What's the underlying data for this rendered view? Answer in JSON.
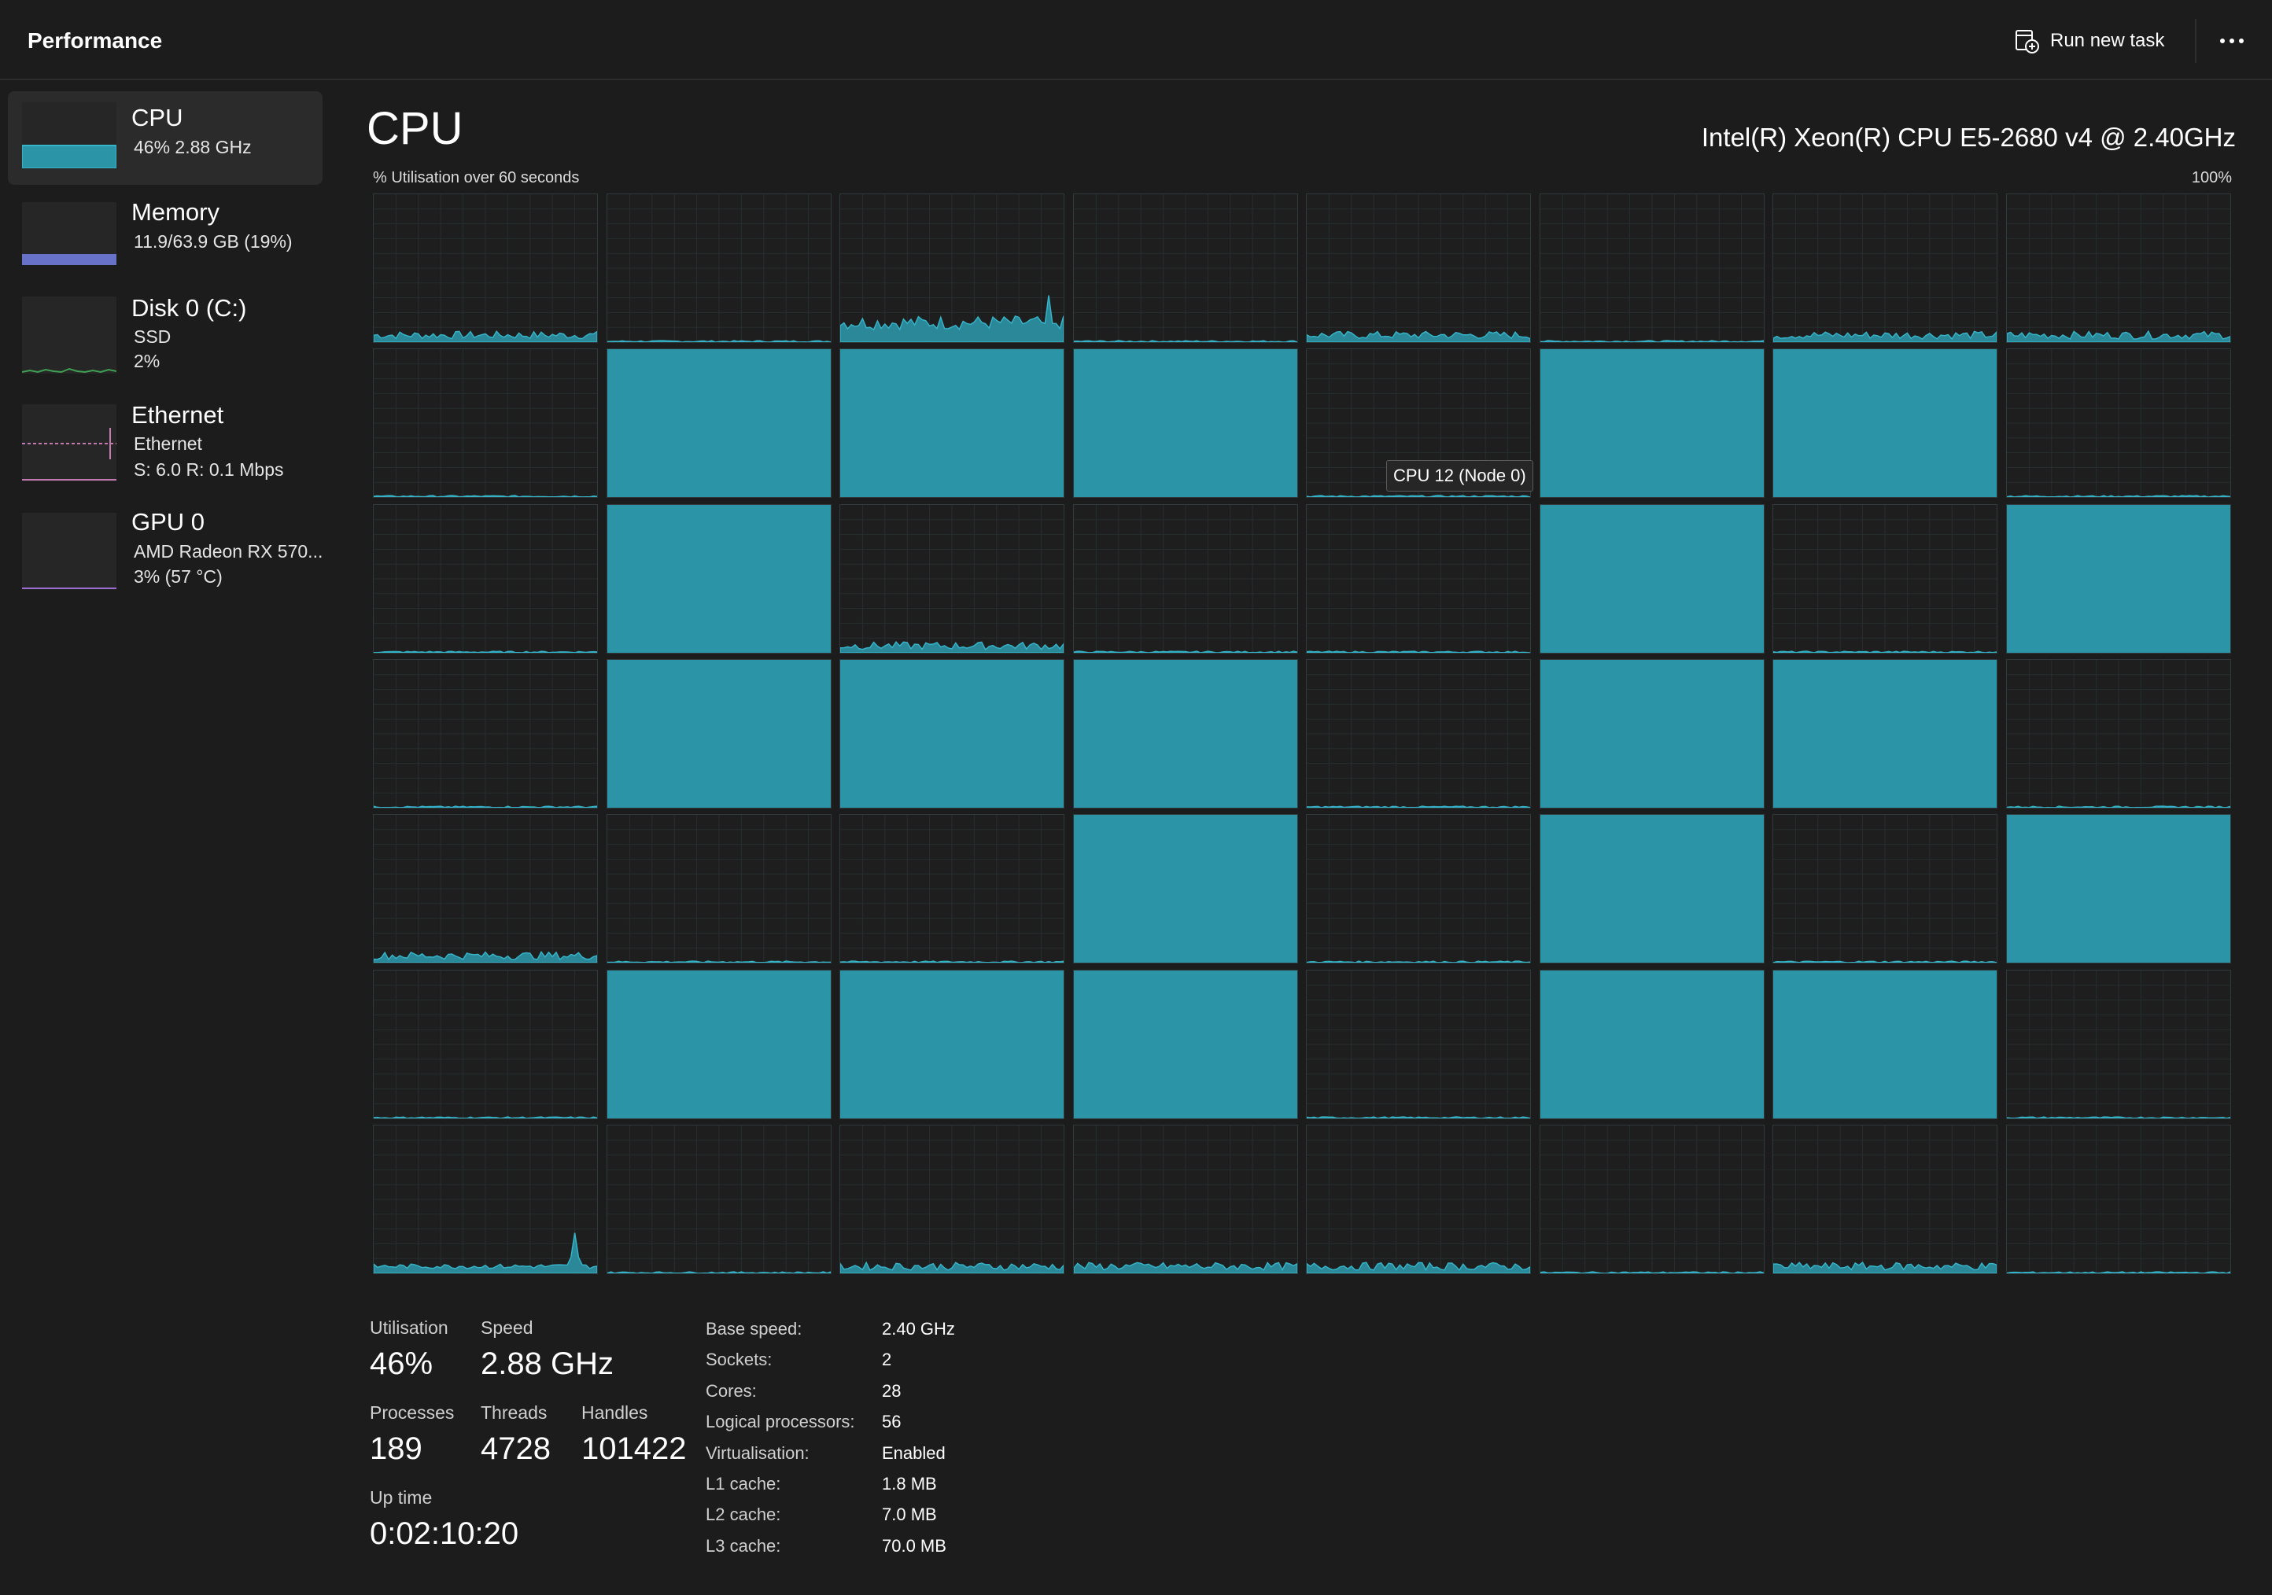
{
  "header": {
    "title": "Performance",
    "run_new_task": "Run new task",
    "more_icon": "more-horizontal-icon",
    "run_icon": "run-task-icon"
  },
  "sidebar": {
    "items": [
      {
        "name": "CPU",
        "details": [
          "46%  2.88 GHz"
        ],
        "color": "#2b94a6",
        "level": 0.46,
        "selected": true
      },
      {
        "name": "Memory",
        "details": [
          "11.9/63.9 GB (19%)"
        ],
        "color": "#7280d4",
        "level": 0.19,
        "selected": false
      },
      {
        "name": "Disk 0 (C:)",
        "details": [
          "SSD",
          "2%"
        ],
        "color": "#3f9f52",
        "level": 0.02,
        "selected": false
      },
      {
        "name": "Ethernet",
        "details": [
          "Ethernet",
          "S: 6.0  R: 0.1 Mbps"
        ],
        "color": "#c27ab0",
        "selected": false
      },
      {
        "name": "GPU 0",
        "details": [
          "AMD Radeon RX 570...",
          "3%  (57 °C)"
        ],
        "color": "#9a6bd0",
        "level": 0.03,
        "selected": false
      }
    ]
  },
  "main": {
    "title": "CPU",
    "model": "Intel(R) Xeon(R) CPU E5-2680 v4 @ 2.40GHz",
    "graph_caption": "% Utilisation over 60 seconds",
    "graph_max": "100%",
    "tooltip": "CPU 12 (Node 0)",
    "accent_color": "#2b94a6",
    "logical_processor_load": [
      "low",
      "idle",
      "medium",
      "idle",
      "low",
      "idle",
      "low",
      "low",
      "idle",
      "full",
      "full",
      "full",
      "idle",
      "full",
      "full",
      "idle",
      "idle",
      "full",
      "low",
      "idle",
      "idle",
      "full",
      "idle",
      "full",
      "idle",
      "full",
      "full",
      "full",
      "idle",
      "full",
      "full",
      "idle",
      "low",
      "idle",
      "idle",
      "full",
      "idle",
      "full",
      "idle",
      "full",
      "idle",
      "full",
      "full",
      "full",
      "idle",
      "full",
      "full",
      "idle",
      "spike",
      "idle",
      "low",
      "low",
      "low",
      "idle",
      "low",
      "idle"
    ]
  },
  "stats": {
    "utilisation_label": "Utilisation",
    "utilisation": "46%",
    "speed_label": "Speed",
    "speed": "2.88 GHz",
    "processes_label": "Processes",
    "processes": "189",
    "threads_label": "Threads",
    "threads": "4728",
    "handles_label": "Handles",
    "handles": "101422",
    "uptime_label": "Up time",
    "uptime": "0:02:10:20"
  },
  "specs": [
    {
      "key": "Base speed:",
      "value": "2.40 GHz"
    },
    {
      "key": "Sockets:",
      "value": "2"
    },
    {
      "key": "Cores:",
      "value": "28"
    },
    {
      "key": "Logical processors:",
      "value": "56"
    },
    {
      "key": "Virtualisation:",
      "value": "Enabled"
    },
    {
      "key": "L1 cache:",
      "value": "1.8 MB"
    },
    {
      "key": "L2 cache:",
      "value": "7.0 MB"
    },
    {
      "key": "L3 cache:",
      "value": "70.0 MB"
    }
  ]
}
